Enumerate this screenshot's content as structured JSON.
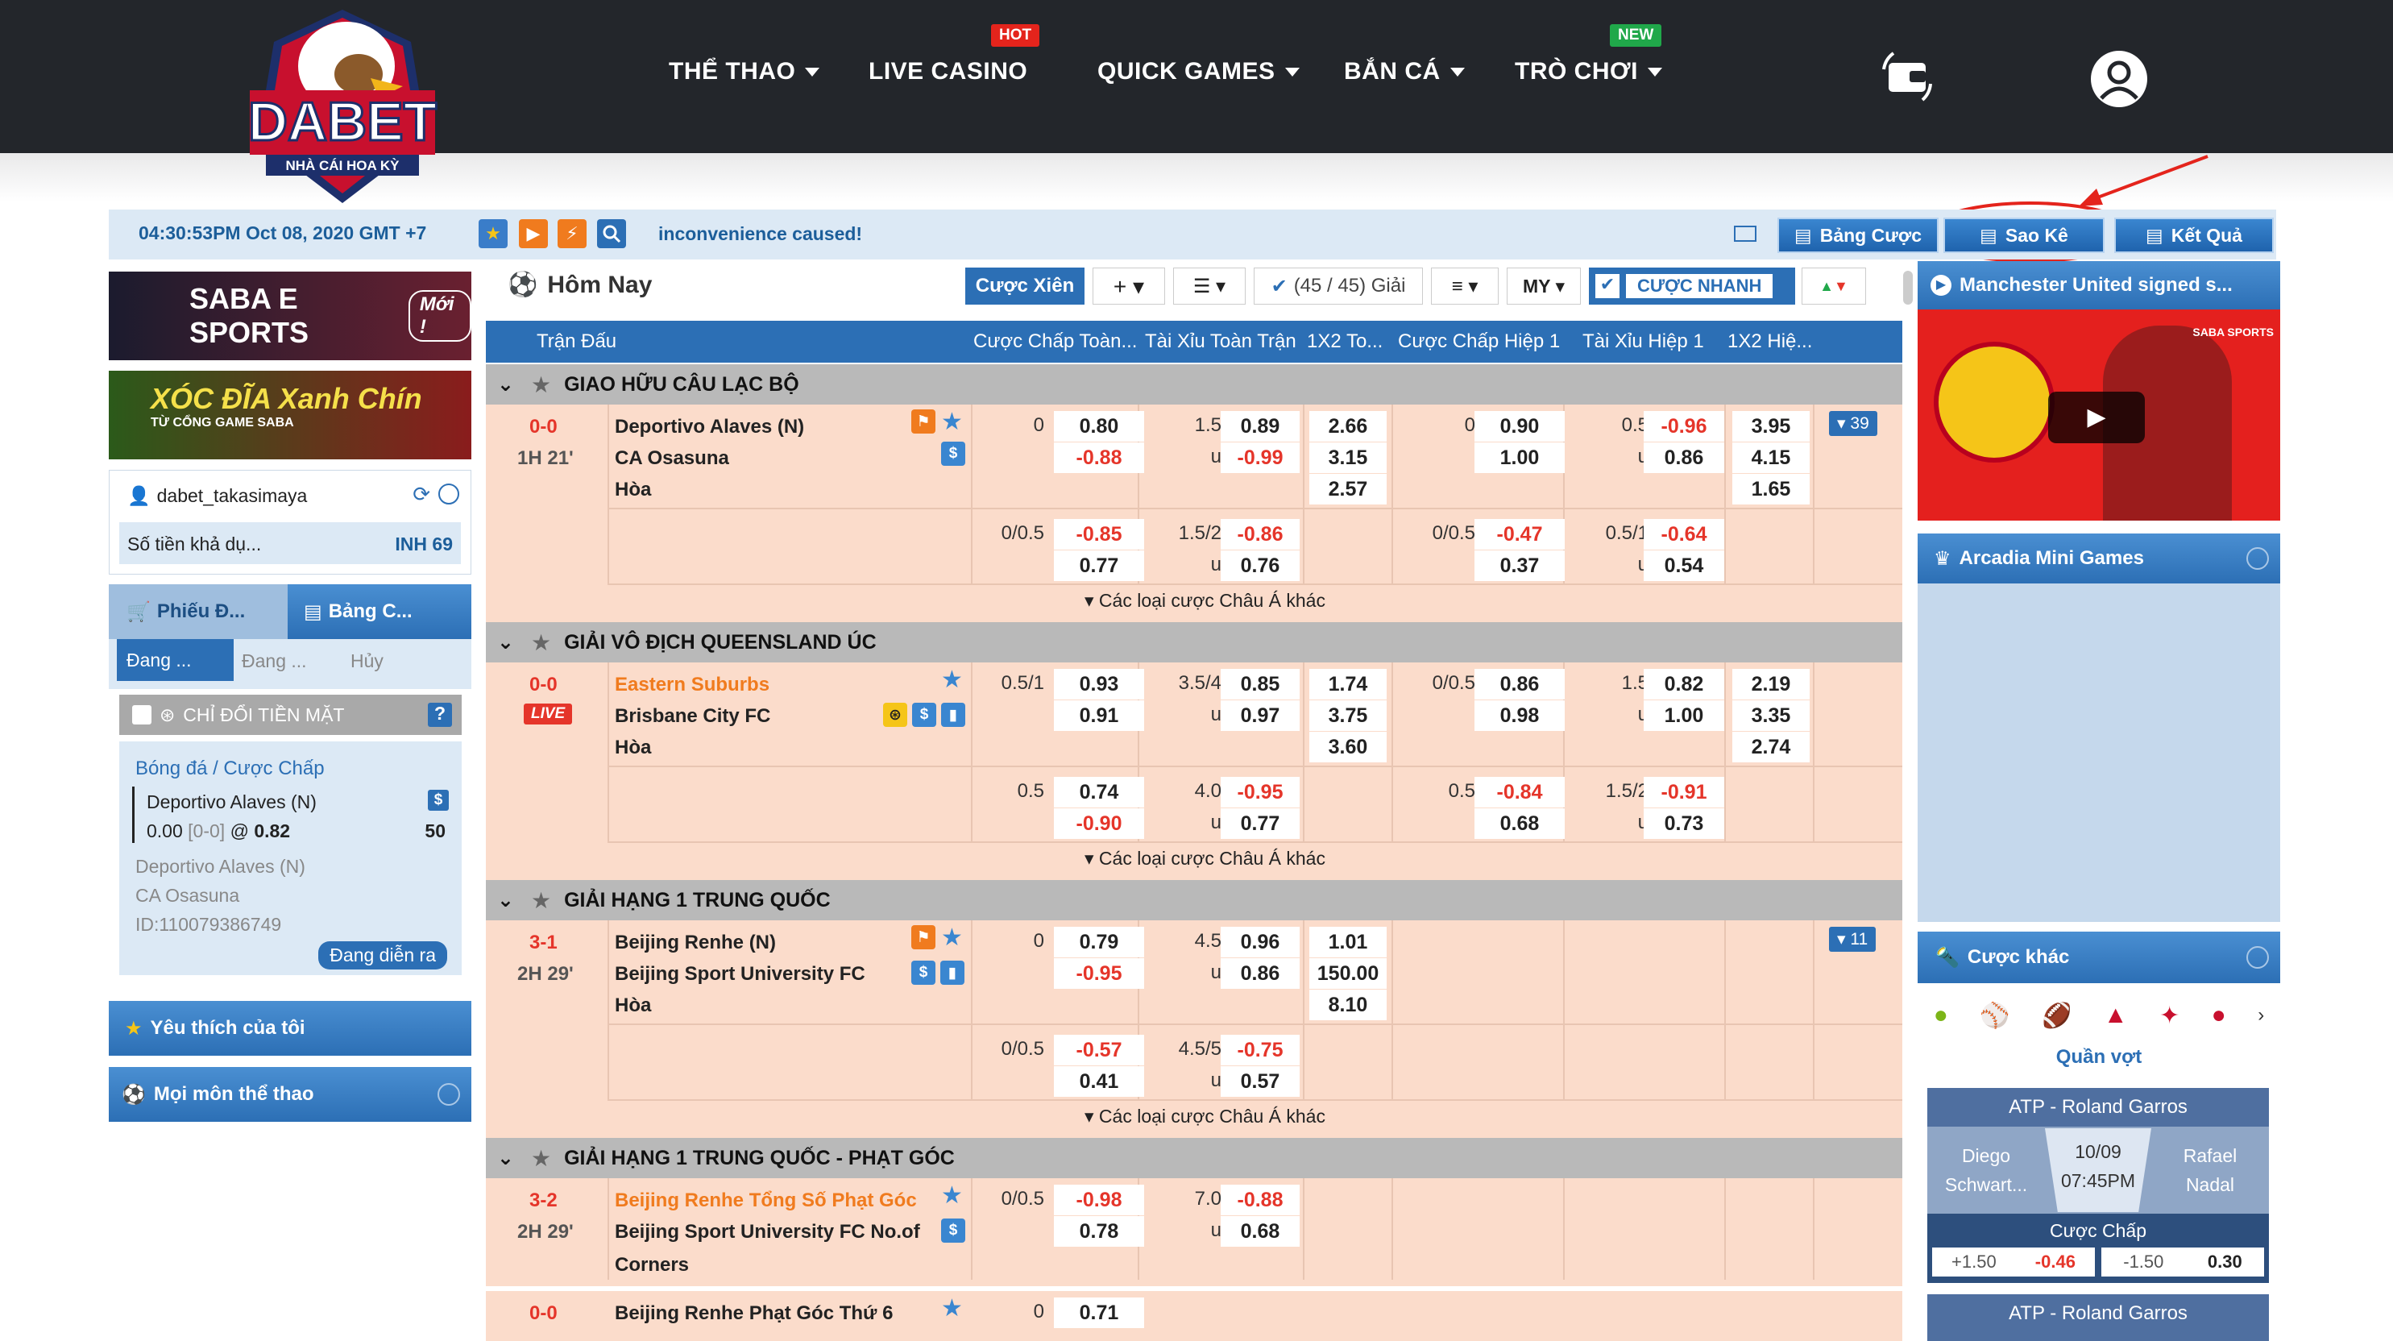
{
  "nav": {
    "items": [
      "THỂ THAO",
      "LIVE CASINO",
      "QUICK GAMES",
      "BẮN CÁ",
      "TRÒ CHƠI"
    ],
    "badge_hot": "HOT",
    "badge_new": "NEW"
  },
  "logo": {
    "brand": "DABET",
    "tagline": "NHÀ CÁI HOA KỲ"
  },
  "infobar": {
    "clock": "04:30:53PM Oct 08, 2020 GMT +7",
    "ticker": "inconvenience caused!",
    "btn_bang_cuoc": "Bảng Cược",
    "btn_sao_ke": "Sao Kê",
    "btn_ket_qua": "Kết Quả"
  },
  "left": {
    "banner1": "SABA E SPORTS",
    "banner1_badge": "Mới !",
    "banner2": "XÓC ĐĨA Xanh Chín",
    "banner2_sub": "TỪ CỔNG GAME SABA",
    "username": "dabet_takasimaya",
    "balance_label": "Số tiền khả dụ...",
    "balance_value": "INH 69",
    "tab1": "Phiếu Đ...",
    "tab2": "Bảng C...",
    "subtab1": "Đang ...",
    "subtab2": "Đang ...",
    "subtab3": "Hủy",
    "chk_label": "CHỈ ĐỔI TIỀN MẶT",
    "bet_cat": "Bóng đá / Cược Chấp",
    "bet_team": "Deportivo Alaves (N)",
    "bet_line": "0.00",
    "bet_score": "[0-0]",
    "bet_at": "@",
    "bet_odds": "0.82",
    "bet_stake": "50",
    "bet_home": "Deportivo Alaves (N)",
    "bet_away": "CA Osasuna",
    "bet_id": "ID:110079386749",
    "bet_status": "Đang diễn ra",
    "favorite": "Yêu thích của tôi",
    "all_sports": "Mọi môn thể thao"
  },
  "toolbar": {
    "title": "Hôm Nay",
    "parlay": "Cược Xiên",
    "leagues": "(45 / 45) Giải",
    "oddstype": "MY",
    "quick": "CƯỢC NHANH"
  },
  "table_headers": [
    "Trận Đấu",
    "Cược Chấp Toàn...",
    "Tài Xỉu Toàn Trận",
    "1X2 To...",
    "Cược Chấp Hiệp 1",
    "Tài Xỉu Hiệp 1",
    "1X2 Hiệ..."
  ],
  "more_text": "Các loại cược Châu Á khác",
  "leagues": [
    {
      "name": "GIAO HỮU CÂU LẠC BỘ"
    },
    {
      "name": "GIẢI VÔ ĐỊCH QUEENSLAND ÚC"
    },
    {
      "name": "GIẢI HẠNG 1 TRUNG QUỐC"
    },
    {
      "name": "GIẢI HẠNG 1 TRUNG QUỐC - PHẠT GÓC"
    }
  ],
  "m1": {
    "score": "0-0",
    "time": "1H 21'",
    "home": "Deportivo Alaves (N)",
    "away": "CA Osasuna",
    "draw": "Hòa",
    "more": "39",
    "r1": [
      "0",
      "0.80",
      "1.5",
      "0.89",
      "2.66",
      "0",
      "0.90",
      "0.5",
      "-0.96",
      "3.95"
    ],
    "r2": [
      "-0.88",
      "u",
      "-0.99",
      "3.15",
      "1.00",
      "u",
      "0.86",
      "4.15"
    ],
    "r3": [
      "2.57",
      "1.65"
    ],
    "r4": [
      "0/0.5",
      "-0.85",
      "1.5/2",
      "-0.86",
      "0/0.5",
      "-0.47",
      "0.5/1",
      "-0.64"
    ],
    "r5": [
      "0.77",
      "u",
      "0.76",
      "0.37",
      "u",
      "0.54"
    ]
  },
  "m2": {
    "score": "0-0",
    "live": "LIVE",
    "home": "Eastern Suburbs",
    "away": "Brisbane City FC",
    "draw": "Hòa",
    "r1": [
      "0.5/1",
      "0.93",
      "3.5/4",
      "0.85",
      "1.74",
      "0/0.5",
      "0.86",
      "1.5",
      "0.82",
      "2.19"
    ],
    "r2": [
      "0.91",
      "u",
      "0.97",
      "3.75",
      "0.98",
      "u",
      "1.00",
      "3.35"
    ],
    "r3": [
      "3.60",
      "2.74"
    ],
    "r4": [
      "0.5",
      "0.74",
      "4.0",
      "-0.95",
      "0.5",
      "-0.84",
      "1.5/2",
      "-0.91"
    ],
    "r5": [
      "-0.90",
      "u",
      "0.77",
      "0.68",
      "u",
      "0.73"
    ]
  },
  "m3": {
    "score": "3-1",
    "time": "2H 29'",
    "home": "Beijing Renhe (N)",
    "away": "Beijing Sport University FC",
    "draw": "Hòa",
    "more": "11",
    "r1": [
      "0",
      "0.79",
      "4.5",
      "0.96",
      "1.01"
    ],
    "r2": [
      "-0.95",
      "u",
      "0.86",
      "150.00"
    ],
    "r3": [
      "8.10"
    ],
    "r4": [
      "0/0.5",
      "-0.57",
      "4.5/5",
      "-0.75"
    ],
    "r5": [
      "0.41",
      "u",
      "0.57"
    ]
  },
  "m4": {
    "score": "3-2",
    "time": "2H 29'",
    "home": "Beijing Renhe Tổng Số Phạt Góc",
    "away": "Beijing Sport University FC No.of",
    "away2": "Corners",
    "r1": [
      "0/0.5",
      "-0.98",
      "7.0",
      "-0.88"
    ],
    "r2": [
      "0.78",
      "u",
      "0.68"
    ]
  },
  "m5": {
    "score": "0-0",
    "home": "Beijing Renhe Phạt Góc Thứ 6",
    "r1": [
      "0",
      "0.71"
    ]
  },
  "right": {
    "video_title": "Manchester United signed s...",
    "video_brand": "SABA SPORTS",
    "arcadia": "Arcadia Mini Games",
    "other": "Cược khác",
    "sport": "Quần vợt",
    "t1_title": "ATP - Roland Garros",
    "t1_p1": "Diego Schwart...",
    "t1_p2": "Rafael Nadal",
    "t1_date": "10/09",
    "t1_time": "07:45PM",
    "t1_market": "Cược Chấp",
    "t1_h1": "+1.50",
    "t1_o1": "-0.46",
    "t1_h2": "-1.50",
    "t1_o2": "0.30",
    "t2_title": "ATP - Roland Garros"
  }
}
